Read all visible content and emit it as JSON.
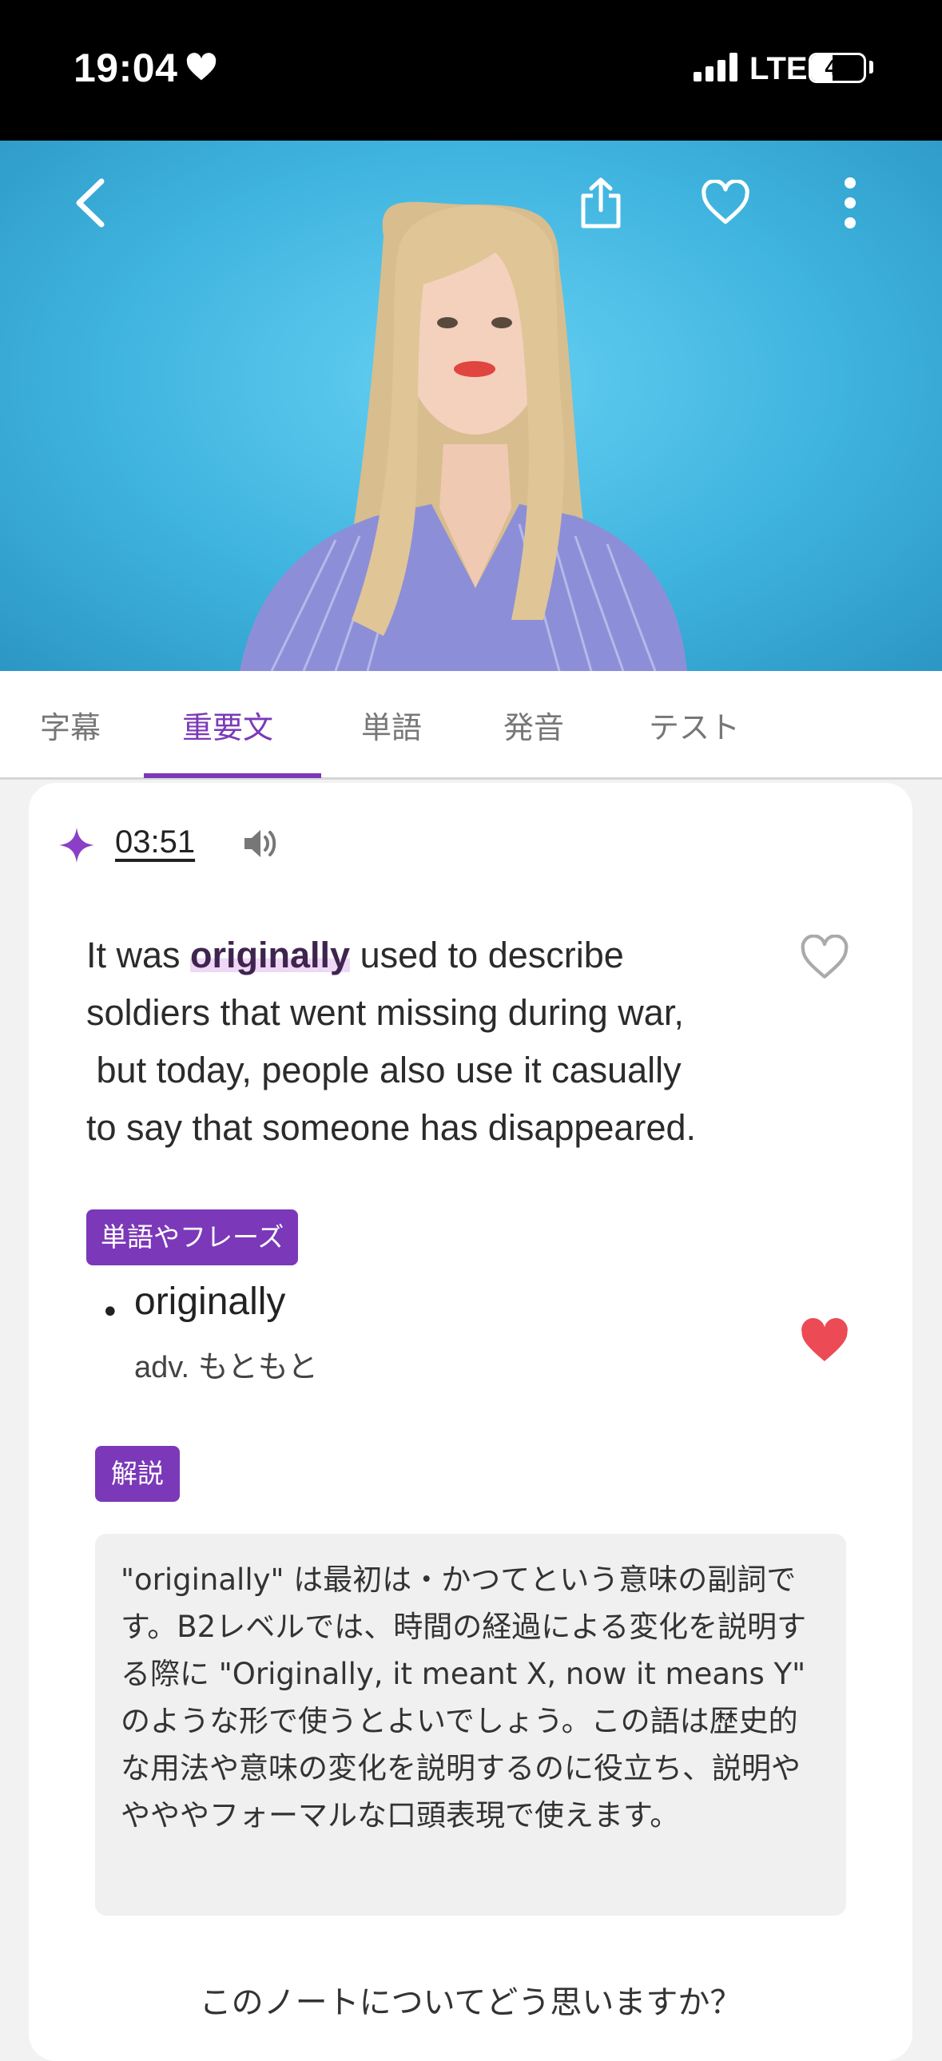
{
  "status_bar": {
    "time": "19:04",
    "network": "LTE",
    "battery": "41",
    "battery_level": 0.41
  },
  "video": {
    "actions": [
      "back-icon",
      "share-icon",
      "favorite-icon",
      "more-icon"
    ]
  },
  "tabs": [
    {
      "label": "字幕",
      "active": false
    },
    {
      "label": "重要文",
      "active": true
    },
    {
      "label": "単語",
      "active": false
    },
    {
      "label": "発音",
      "active": false
    },
    {
      "label": "テスト",
      "active": false
    }
  ],
  "card": {
    "timestamp": "03:51",
    "sentence": {
      "before": "It was ",
      "highlight": "originally",
      "after": " used to describe\nsoldiers that went missing during war,\n but today, people also use it casually\nto say that someone has disappeared."
    },
    "phrases_tag": "単語やフレーズ",
    "vocab": {
      "word": "originally",
      "definition": "adv. もともと",
      "favorited": true
    },
    "explanation_tag": "解説",
    "explanation": "\"originally\" は最初は・かつてという意味の副詞です。B2レベルでは、時間の経過による変化を説明する際に \"Originally, it meant X, now it means Y\" のような形で使うとよいでしょう。この語は歴史的な用法や意味の変化を説明するのに役立ち、説明ややややフォーマルな口頭表現で使えます。",
    "feedback_prompt": "このノートについてどう思いますか？"
  },
  "colors": {
    "accent": "#7b38b8",
    "heart_active": "#ec4a55",
    "video_background": "#4cc2ea"
  }
}
